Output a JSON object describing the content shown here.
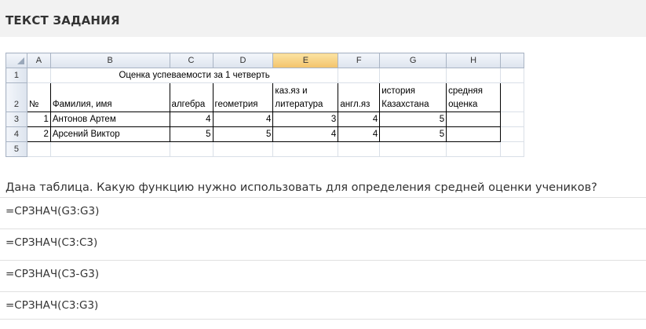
{
  "header": {
    "title": "ТЕКСТ ЗАДАНИЯ"
  },
  "sheet": {
    "columns": [
      "A",
      "B",
      "C",
      "D",
      "E",
      "F",
      "G",
      "H"
    ],
    "selected_column": "E",
    "rows": [
      "1",
      "2",
      "3",
      "4",
      "5"
    ],
    "title": "Оценка успеваемости за 1 четверть",
    "headers": {
      "a": "№",
      "b": "Фамилия, имя",
      "c": "алгебра",
      "d": "геометрия",
      "e1": "каз.яз и",
      "e2": "литература",
      "f": "англ.яз",
      "g1": "история",
      "g2": "Казахстана",
      "h1": "средняя",
      "h2": "оценка"
    },
    "data": [
      {
        "num": "1",
        "name": "Антонов Артем",
        "c": "4",
        "d": "4",
        "e": "3",
        "f": "4",
        "g": "5",
        "h": ""
      },
      {
        "num": "2",
        "name": "Арсений Виктор",
        "c": "5",
        "d": "5",
        "e": "4",
        "f": "4",
        "g": "5",
        "h": ""
      }
    ]
  },
  "question": "Дана таблица. Какую функцию нужно использовать для определения средней оценки учеников?",
  "options": [
    "=СРЗНАЧ(G3:G3)",
    "=СРЗНАЧ(C3:C3)",
    "=СРЗНАЧ(C3-G3)",
    "=СРЗНАЧ(C3:G3)"
  ]
}
